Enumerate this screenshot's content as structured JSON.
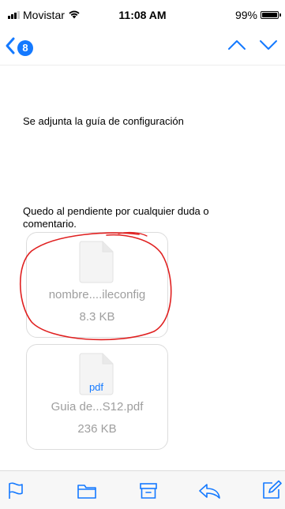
{
  "status_bar": {
    "carrier": "Movistar",
    "time": "11:08 AM",
    "battery": "99%"
  },
  "nav": {
    "unread_count": "8"
  },
  "message": {
    "line1": "Se adjunta la guía de configuración",
    "line2": "Quedo al pendiente por cualquier duda o",
    "line3": "comentario."
  },
  "attachments": [
    {
      "name": "nombre....ileconfig",
      "size": "8.3 KB",
      "type_label": ""
    },
    {
      "name": "Guia de...S12.pdf",
      "size": "236 KB",
      "type_label": "pdf"
    }
  ],
  "colors": {
    "accent": "#1479ff",
    "annotation": "#e02020",
    "muted_text": "#9e9e9e"
  },
  "toolbar": {
    "icons": [
      "flag-icon",
      "folder-icon",
      "archive-icon",
      "reply-icon",
      "compose-icon"
    ]
  }
}
